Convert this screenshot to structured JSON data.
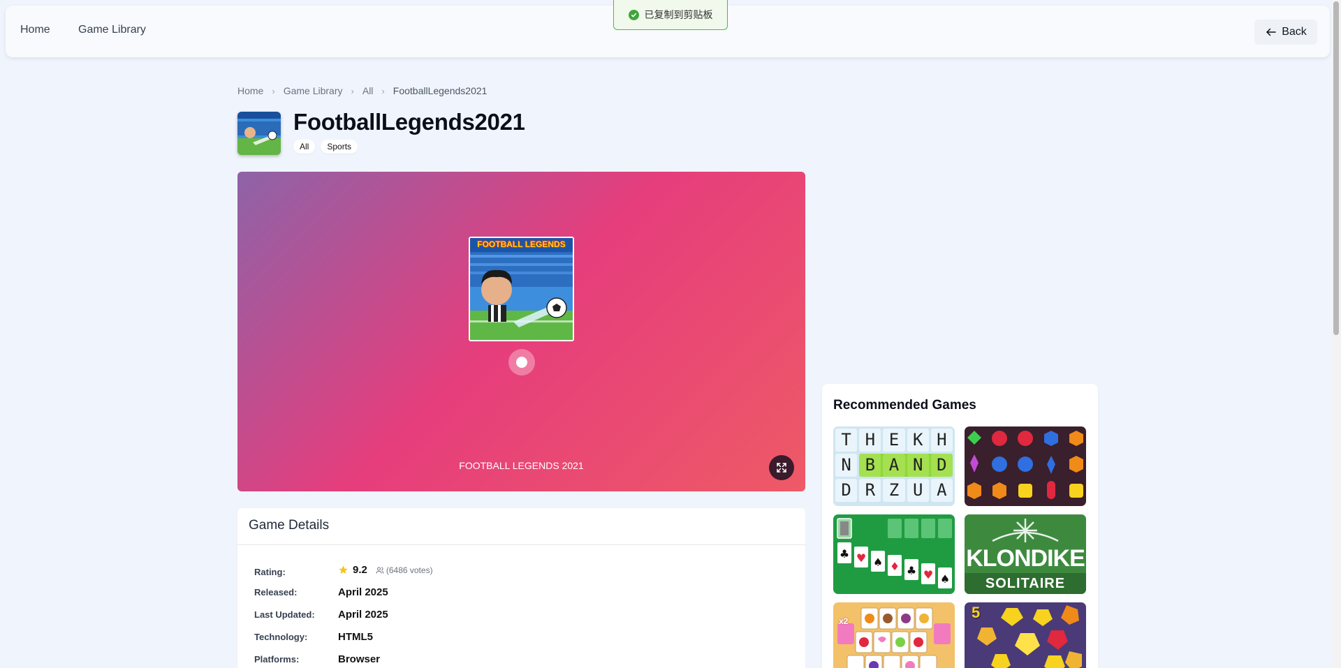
{
  "nav": {
    "home": "Home",
    "library": "Game Library",
    "back": "Back"
  },
  "toast": {
    "message": "已复制到剪贴板"
  },
  "breadcrumb": {
    "home": "Home",
    "library": "Game Library",
    "category": "All",
    "current": "FootballLegends2021"
  },
  "game": {
    "title": "FootballLegends2021",
    "tags": [
      "All",
      "Sports"
    ],
    "cover_text": "FOOTBALL LEGENDS",
    "player_caption": "FOOTBALL LEGENDS 2021"
  },
  "details": {
    "title": "Game Details",
    "rating_label": "Rating:",
    "rating": "9.2",
    "votes": "(6486 votes)",
    "released_label": "Released:",
    "released": "April 2025",
    "updated_label": "Last Updated:",
    "updated": "April 2025",
    "technology_label": "Technology:",
    "technology": "HTML5",
    "platforms_label": "Platforms:",
    "platforms": "Browser"
  },
  "recommended": {
    "title": "Recommended Games",
    "word_game": {
      "row1": [
        "T",
        "H",
        "E",
        "K",
        "H"
      ],
      "row2": [
        "N",
        "B",
        "A",
        "N",
        "D"
      ],
      "row3": [
        "D",
        "R",
        "Z",
        "U",
        "A"
      ]
    },
    "klondike": {
      "line1": "KLONDIKE",
      "line2": "SOLITAIRE"
    },
    "jewel_count": "5",
    "mahjong_badge": "x2"
  },
  "colors": {
    "accent": "#e63d7c",
    "page_bg": "#f0f5fd",
    "toast_green": "#3fa63b"
  }
}
